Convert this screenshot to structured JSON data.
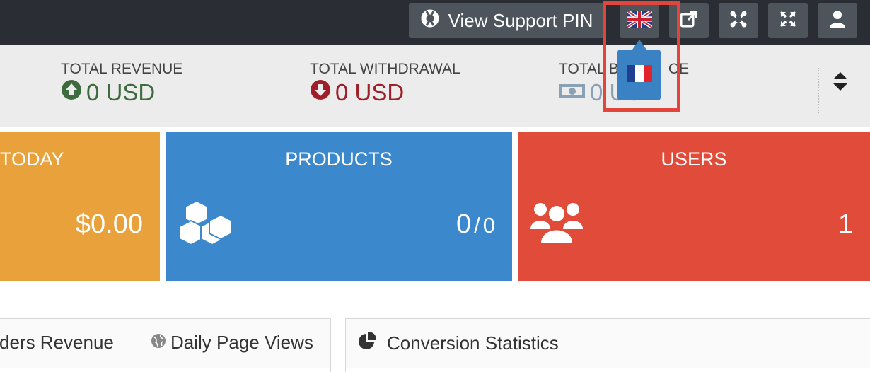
{
  "topbar": {
    "support_pin_label": "View Support PIN",
    "current_language_flag": "uk-flag",
    "dropdown_language_flag": "france-flag"
  },
  "stats": {
    "revenue": {
      "label": "TOTAL REVENUE",
      "value": "0 USD",
      "color": "#3e6b3e",
      "icon": "arrow-up-circle-icon"
    },
    "withdrawal": {
      "label": "TOTAL WITHDRAWAL",
      "value": "0 USD",
      "color": "#9e1f2a",
      "icon": "arrow-down-circle-icon"
    },
    "balance": {
      "label": "TOTAL BALANCE",
      "label_visible": "TOTAL B",
      "label_tail_visible": "CE",
      "value": "0 USD",
      "color": "#8aa0b4",
      "icon": "money-icon"
    }
  },
  "tiles": {
    "today": {
      "title": "TODAY",
      "value": "$0.00",
      "color": "#e9a23b"
    },
    "products": {
      "title": "PRODUCTS",
      "value_left": "0",
      "value_sep": "/",
      "value_right": "0",
      "color": "#3b88cc",
      "icon": "cubes-icon"
    },
    "users": {
      "title": "USERS",
      "value": "1",
      "color": "#e04b3a",
      "icon": "users-icon"
    }
  },
  "panels": {
    "left_tabs": [
      {
        "label": "ders Revenue"
      },
      {
        "label": "Daily Page Views",
        "icon": "globe-icon"
      }
    ],
    "right_title": "Conversion Statistics",
    "right_icon": "pie-chart-icon"
  },
  "colors": {
    "highlight": "#e2463a",
    "dropdown": "#3b82c4",
    "topbar": "#2a2e34"
  }
}
